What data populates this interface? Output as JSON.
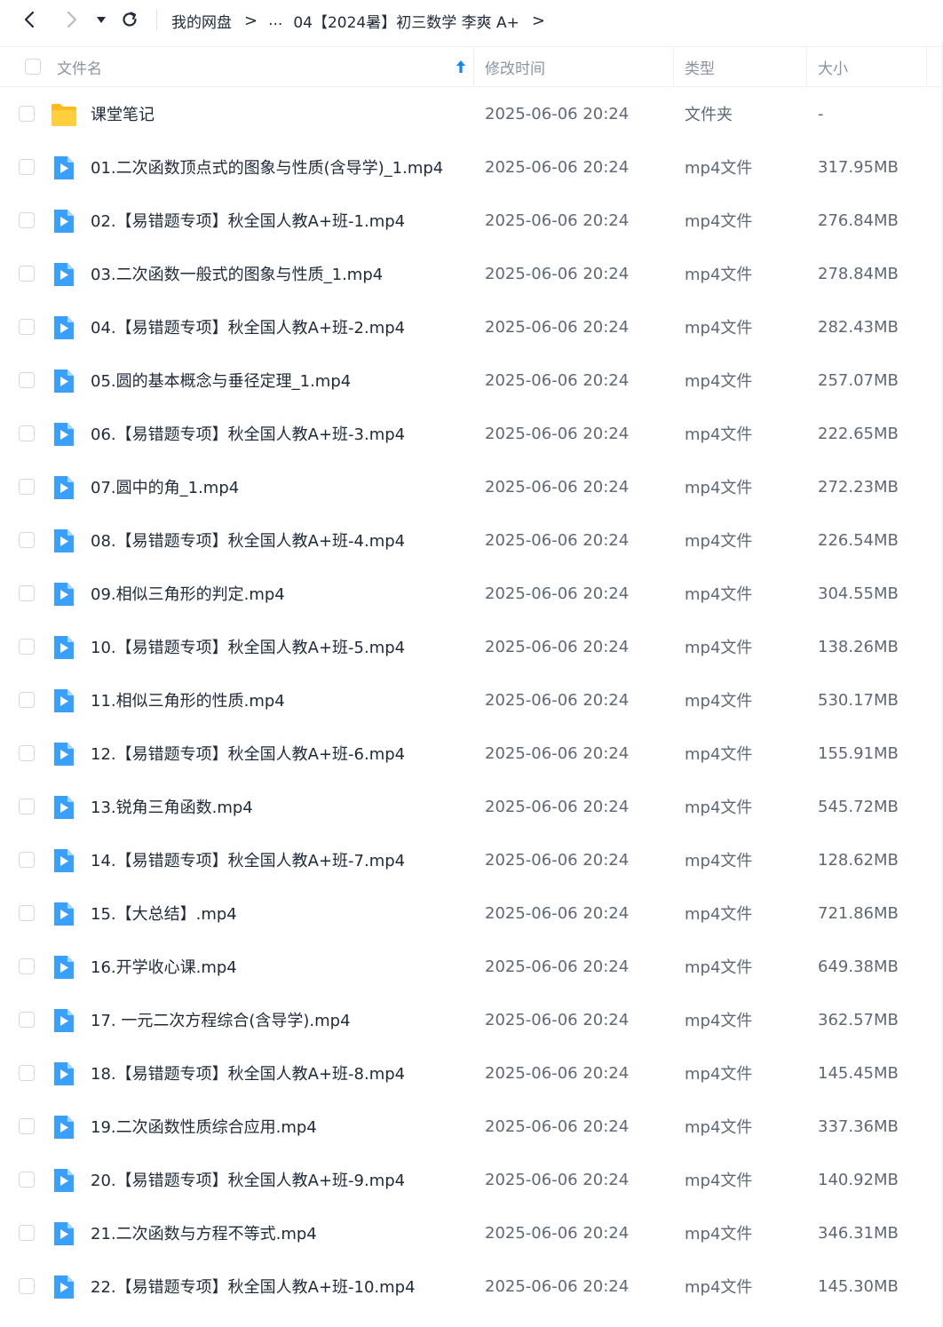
{
  "toolbar": {
    "back_icon": "chevron-left-icon",
    "forward_icon": "chevron-right-icon",
    "dropdown_icon": "caret-down-icon",
    "refresh_icon": "refresh-icon"
  },
  "breadcrumb": {
    "root": "我的网盘",
    "separator": ">",
    "ellipsis": "...",
    "current": "04【2024暑】初三数学 李爽 A+"
  },
  "columns": {
    "name": "文件名",
    "mtime": "修改时间",
    "type": "类型",
    "size": "大小"
  },
  "colors": {
    "accent": "#0a84ff",
    "folder": "#ffc42e",
    "video_icon": "#3aa0ff"
  },
  "files": [
    {
      "name": "课堂笔记",
      "mtime": "2025-06-06 20:24",
      "type": "文件夹",
      "size": "-",
      "icon": "folder-icon"
    },
    {
      "name": "01.二次函数顶点式的图象与性质(含导学)_1.mp4",
      "mtime": "2025-06-06 20:24",
      "type": "mp4文件",
      "size": "317.95MB",
      "icon": "video-file-icon"
    },
    {
      "name": "02.【易错题专项】秋全国人教A+班-1.mp4",
      "mtime": "2025-06-06 20:24",
      "type": "mp4文件",
      "size": "276.84MB",
      "icon": "video-file-icon"
    },
    {
      "name": "03.二次函数一般式的图象与性质_1.mp4",
      "mtime": "2025-06-06 20:24",
      "type": "mp4文件",
      "size": "278.84MB",
      "icon": "video-file-icon"
    },
    {
      "name": "04.【易错题专项】秋全国人教A+班-2.mp4",
      "mtime": "2025-06-06 20:24",
      "type": "mp4文件",
      "size": "282.43MB",
      "icon": "video-file-icon"
    },
    {
      "name": "05.圆的基本概念与垂径定理_1.mp4",
      "mtime": "2025-06-06 20:24",
      "type": "mp4文件",
      "size": "257.07MB",
      "icon": "video-file-icon"
    },
    {
      "name": "06.【易错题专项】秋全国人教A+班-3.mp4",
      "mtime": "2025-06-06 20:24",
      "type": "mp4文件",
      "size": "222.65MB",
      "icon": "video-file-icon"
    },
    {
      "name": "07.圆中的角_1.mp4",
      "mtime": "2025-06-06 20:24",
      "type": "mp4文件",
      "size": "272.23MB",
      "icon": "video-file-icon"
    },
    {
      "name": "08.【易错题专项】秋全国人教A+班-4.mp4",
      "mtime": "2025-06-06 20:24",
      "type": "mp4文件",
      "size": "226.54MB",
      "icon": "video-file-icon"
    },
    {
      "name": "09.相似三角形的判定.mp4",
      "mtime": "2025-06-06 20:24",
      "type": "mp4文件",
      "size": "304.55MB",
      "icon": "video-file-icon"
    },
    {
      "name": "10.【易错题专项】秋全国人教A+班-5.mp4",
      "mtime": "2025-06-06 20:24",
      "type": "mp4文件",
      "size": "138.26MB",
      "icon": "video-file-icon"
    },
    {
      "name": "11.相似三角形的性质.mp4",
      "mtime": "2025-06-06 20:24",
      "type": "mp4文件",
      "size": "530.17MB",
      "icon": "video-file-icon"
    },
    {
      "name": "12.【易错题专项】秋全国人教A+班-6.mp4",
      "mtime": "2025-06-06 20:24",
      "type": "mp4文件",
      "size": "155.91MB",
      "icon": "video-file-icon"
    },
    {
      "name": "13.锐角三角函数.mp4",
      "mtime": "2025-06-06 20:24",
      "type": "mp4文件",
      "size": "545.72MB",
      "icon": "video-file-icon"
    },
    {
      "name": "14.【易错题专项】秋全国人教A+班-7.mp4",
      "mtime": "2025-06-06 20:24",
      "type": "mp4文件",
      "size": "128.62MB",
      "icon": "video-file-icon"
    },
    {
      "name": "15.【大总结】.mp4",
      "mtime": "2025-06-06 20:24",
      "type": "mp4文件",
      "size": "721.86MB",
      "icon": "video-file-icon"
    },
    {
      "name": "16.开学收心课.mp4",
      "mtime": "2025-06-06 20:24",
      "type": "mp4文件",
      "size": "649.38MB",
      "icon": "video-file-icon"
    },
    {
      "name": "17. 一元二次方程综合(含导学).mp4",
      "mtime": "2025-06-06 20:24",
      "type": "mp4文件",
      "size": "362.57MB",
      "icon": "video-file-icon"
    },
    {
      "name": "18.【易错题专项】秋全国人教A+班-8.mp4",
      "mtime": "2025-06-06 20:24",
      "type": "mp4文件",
      "size": "145.45MB",
      "icon": "video-file-icon"
    },
    {
      "name": "19.二次函数性质综合应用.mp4",
      "mtime": "2025-06-06 20:24",
      "type": "mp4文件",
      "size": "337.36MB",
      "icon": "video-file-icon"
    },
    {
      "name": "20.【易错题专项】秋全国人教A+班-9.mp4",
      "mtime": "2025-06-06 20:24",
      "type": "mp4文件",
      "size": "140.92MB",
      "icon": "video-file-icon"
    },
    {
      "name": "21.二次函数与方程不等式.mp4",
      "mtime": "2025-06-06 20:24",
      "type": "mp4文件",
      "size": "346.31MB",
      "icon": "video-file-icon"
    },
    {
      "name": "22.【易错题专项】秋全国人教A+班-10.mp4",
      "mtime": "2025-06-06 20:24",
      "type": "mp4文件",
      "size": "145.30MB",
      "icon": "video-file-icon"
    }
  ]
}
